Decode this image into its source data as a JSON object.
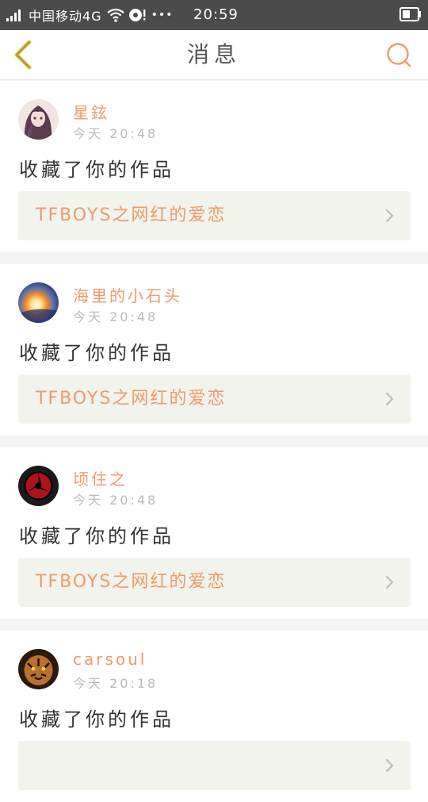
{
  "status_bar": {
    "carrier": "中国移动4G",
    "dots": "•••",
    "time": "20:59",
    "icons": [
      "signal-icon",
      "wifi-icon",
      "notification-icon",
      "battery-icon"
    ]
  },
  "nav": {
    "title": "消息",
    "back_icon": "chevron-left-icon",
    "search_icon": "search-icon"
  },
  "colors": {
    "accent": "#ee9a6a",
    "back_arrow": "#e2c445",
    "status_bar_bg": "#4b4b4b",
    "link_bg": "#f3f3ed"
  },
  "messages": [
    {
      "username": "星鉉",
      "time": "今天 20:48",
      "action": "收藏了你的作品",
      "work_title": "TFBOYS之网红的爱恋"
    },
    {
      "username": "海里的小石头",
      "time": "今天 20:48",
      "action": "收藏了你的作品",
      "work_title": "TFBOYS之网红的爱恋"
    },
    {
      "username": "顷住之",
      "time": "今天 20:48",
      "action": "收藏了你的作品",
      "work_title": "TFBOYS之网红的爱恋"
    },
    {
      "username": "carsoul",
      "time": "今天 20:18",
      "action": "收藏了你的作品",
      "work_title": ""
    }
  ]
}
